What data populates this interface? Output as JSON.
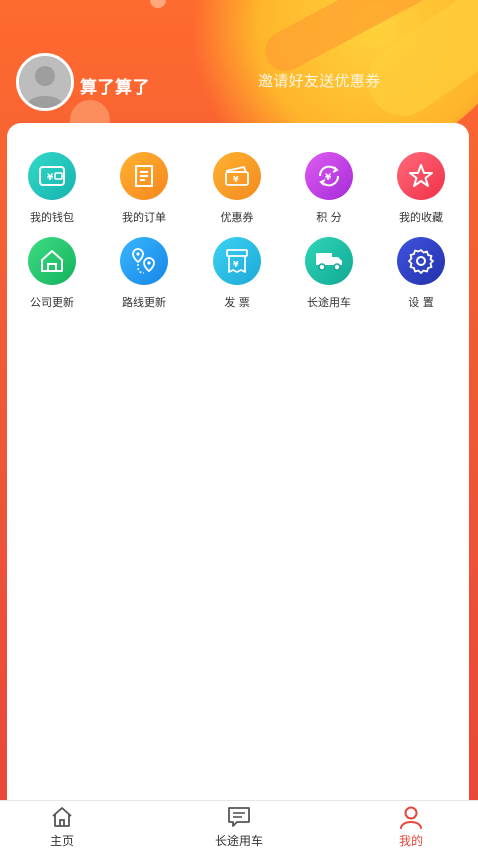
{
  "header": {
    "username": "算了算了",
    "invite_text": "邀请好友送优惠券"
  },
  "menu": [
    {
      "label": "我的钱包",
      "icon": "wallet-icon",
      "color_from": "#33d9c6",
      "color_to": "#16b3b0"
    },
    {
      "label": "我的订单",
      "icon": "order-icon",
      "color_from": "#ffb230",
      "color_to": "#f6861f"
    },
    {
      "label": "优惠券",
      "icon": "coupon-icon",
      "color_from": "#ffb230",
      "color_to": "#f28a1f"
    },
    {
      "label": "积 分",
      "icon": "points-icon",
      "color_from": "#e05cf2",
      "color_to": "#a52bd8"
    },
    {
      "label": "我的收藏",
      "icon": "star-icon",
      "color_from": "#ff6b7a",
      "color_to": "#f02f48"
    },
    {
      "label": "公司更新",
      "icon": "home-icon",
      "color_from": "#3fdc83",
      "color_to": "#12b25c"
    },
    {
      "label": "路线更新",
      "icon": "route-icon",
      "color_from": "#3ab7ff",
      "color_to": "#1585e6"
    },
    {
      "label": "发 票",
      "icon": "invoice-icon",
      "color_from": "#3fd2f2",
      "color_to": "#1aa9d8"
    },
    {
      "label": "长途用车",
      "icon": "truck-icon",
      "color_from": "#2fd6b9",
      "color_to": "#11a893"
    },
    {
      "label": "设 置",
      "icon": "gear-icon",
      "color_from": "#3f54e0",
      "color_to": "#2330a8"
    }
  ],
  "tabbar": {
    "items": [
      {
        "label": "主页",
        "icon": "home-outline-icon"
      },
      {
        "label": "长途用车",
        "icon": "message-icon"
      },
      {
        "label": "我的",
        "icon": "user-icon"
      }
    ],
    "active_index": 2,
    "active_color": "#e5483b"
  }
}
